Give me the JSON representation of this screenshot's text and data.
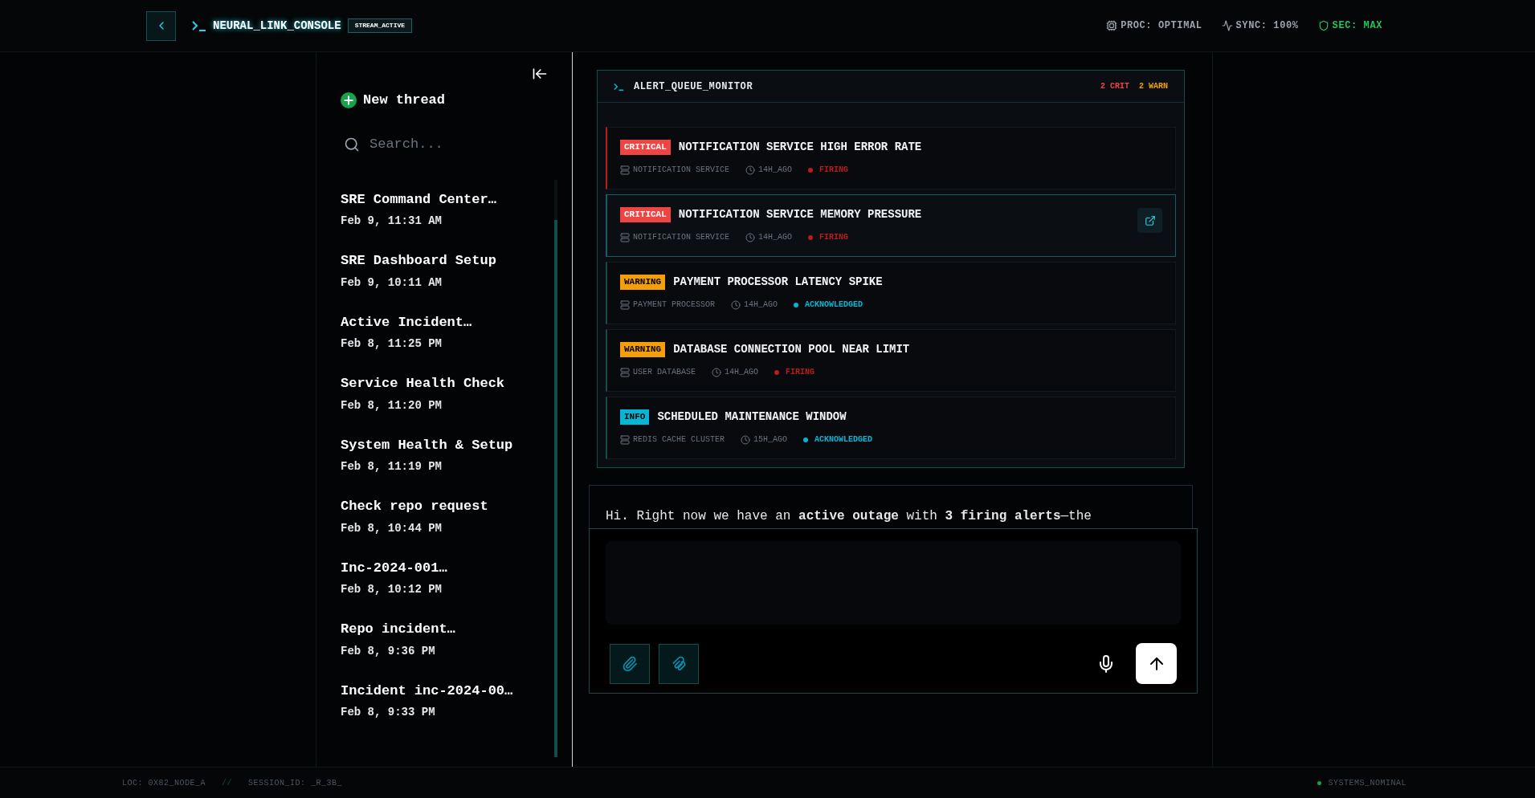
{
  "header": {
    "title": "NEURAL_LINK_CONSOLE",
    "badge": "STREAM_ACTIVE",
    "stats": [
      {
        "kind": "proc",
        "label": "PROC: OPTIMAL"
      },
      {
        "kind": "sync",
        "label": "SYNC: 100%"
      },
      {
        "kind": "sec",
        "label": "SEC: MAX"
      }
    ]
  },
  "sidebar": {
    "new_thread": "New thread",
    "search": {
      "placeholder": "Search..."
    },
    "threads": [
      {
        "title": "SRE Command Center…",
        "time": "Feb 9, 11:31 AM"
      },
      {
        "title": "SRE Dashboard Setup",
        "time": "Feb 9, 10:11 AM"
      },
      {
        "title": "Active Incident…",
        "time": "Feb 8, 11:25 PM"
      },
      {
        "title": "Service Health Check",
        "time": "Feb 8, 11:20 PM"
      },
      {
        "title": "System Health & Setup",
        "time": "Feb 8, 11:19 PM"
      },
      {
        "title": "Check repo request",
        "time": "Feb 8, 10:44 PM"
      },
      {
        "title": "Inc-2024-001…",
        "time": "Feb 8, 10:12 PM"
      },
      {
        "title": "Repo incident…",
        "time": "Feb 8, 9:36 PM"
      },
      {
        "title": "Incident inc-2024-00…",
        "time": "Feb 8, 9:33 PM"
      }
    ]
  },
  "alert_monitor": {
    "title": "ALERT_QUEUE_MONITOR",
    "counts": [
      {
        "kind": "critical",
        "label": "2 CRIT"
      },
      {
        "kind": "warning",
        "label": "2 WARN"
      }
    ],
    "alerts": [
      {
        "kind": "critical",
        "severity": "CRITICAL",
        "title": "NOTIFICATION SERVICE HIGH ERROR RATE",
        "service": "NOTIFICATION SERVICE",
        "age": "14H_AGO",
        "status": {
          "kind": "firing",
          "label": "FIRING"
        },
        "selected": false
      },
      {
        "kind": "critical",
        "severity": "CRITICAL",
        "title": "NOTIFICATION SERVICE MEMORY PRESSURE",
        "service": "NOTIFICATION SERVICE",
        "age": "14H_AGO",
        "status": {
          "kind": "firing",
          "label": "FIRING"
        },
        "selected": true
      },
      {
        "kind": "warning",
        "severity": "WARNING",
        "title": "PAYMENT PROCESSOR LATENCY SPIKE",
        "service": "PAYMENT PROCESSOR",
        "age": "14H_AGO",
        "status": {
          "kind": "acknowledged",
          "label": "ACKNOWLEDGED"
        },
        "selected": false
      },
      {
        "kind": "warning",
        "severity": "WARNING",
        "title": "DATABASE CONNECTION POOL NEAR LIMIT",
        "service": "USER DATABASE",
        "age": "14H_AGO",
        "status": {
          "kind": "firing",
          "label": "FIRING"
        },
        "selected": false
      },
      {
        "kind": "info",
        "severity": "INFO",
        "title": "SCHEDULED MAINTENANCE WINDOW",
        "service": "REDIS CACHE CLUSTER",
        "age": "15H_AGO",
        "status": {
          "kind": "acknowledged",
          "label": "ACKNOWLEDGED"
        },
        "selected": false
      }
    ]
  },
  "message": "Hi. Right now we have an **active outage** with **3 firing alerts**—the",
  "footer": {
    "location": "LOC: 0X82_NODE_A",
    "separator": "//",
    "session": "SESSION_ID: _R_3B_",
    "status": "SYSTEMS_NOMINAL"
  }
}
